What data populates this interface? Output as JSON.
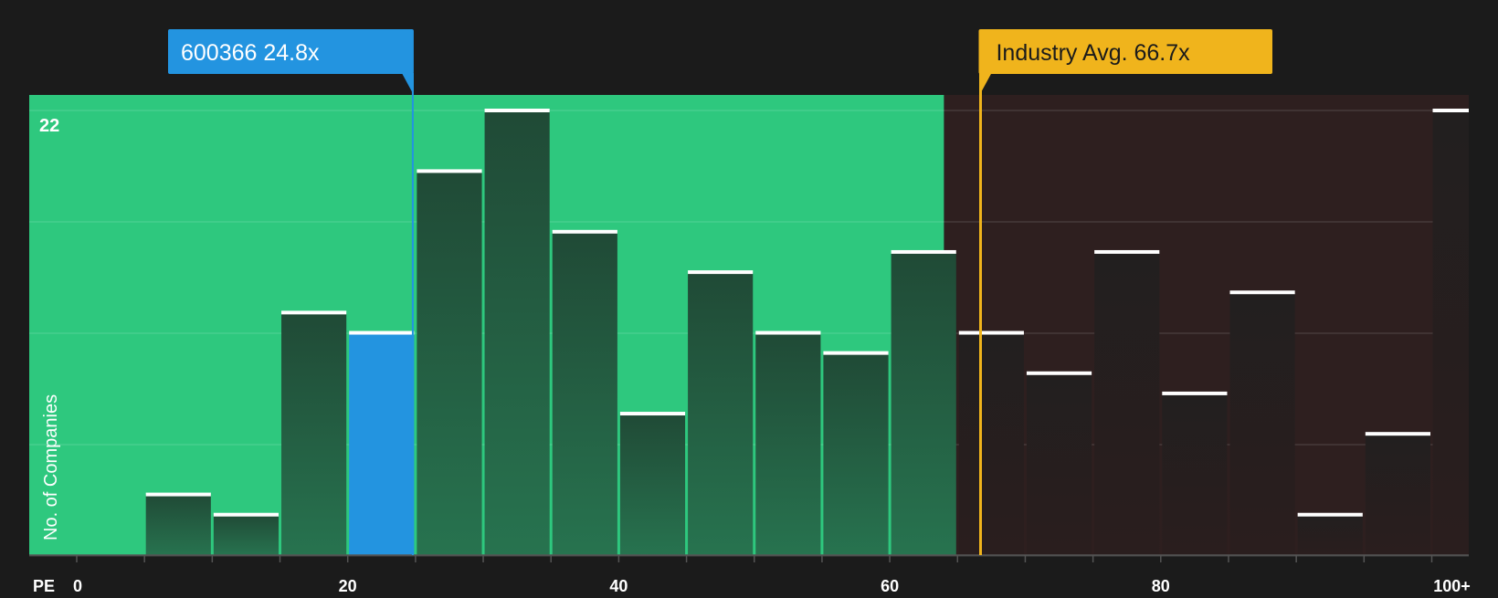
{
  "chart_data": {
    "type": "bar",
    "x_axis_label": "PE",
    "y_axis_label": "No. of Companies",
    "y_max_label": "22",
    "xlim": [
      0,
      100
    ],
    "ylim": [
      0,
      22
    ],
    "x_ticks": [
      {
        "value": 0,
        "label": "0"
      },
      {
        "value": 20,
        "label": "20"
      },
      {
        "value": 40,
        "label": "40"
      },
      {
        "value": 60,
        "label": "60"
      },
      {
        "value": 80,
        "label": "80"
      },
      {
        "value": 100,
        "label": "100+"
      }
    ],
    "bins": [
      {
        "start": 0,
        "end": 5,
        "count": 0
      },
      {
        "start": 5,
        "end": 10,
        "count": 3
      },
      {
        "start": 10,
        "end": 15,
        "count": 2
      },
      {
        "start": 15,
        "end": 20,
        "count": 12
      },
      {
        "start": 20,
        "end": 25,
        "count": 11
      },
      {
        "start": 25,
        "end": 30,
        "count": 19
      },
      {
        "start": 30,
        "end": 35,
        "count": 22
      },
      {
        "start": 35,
        "end": 40,
        "count": 16
      },
      {
        "start": 40,
        "end": 45,
        "count": 7
      },
      {
        "start": 45,
        "end": 50,
        "count": 14
      },
      {
        "start": 50,
        "end": 55,
        "count": 11
      },
      {
        "start": 55,
        "end": 60,
        "count": 10
      },
      {
        "start": 60,
        "end": 65,
        "count": 15
      },
      {
        "start": 65,
        "end": 70,
        "count": 11
      },
      {
        "start": 70,
        "end": 75,
        "count": 9
      },
      {
        "start": 75,
        "end": 80,
        "count": 15
      },
      {
        "start": 80,
        "end": 85,
        "count": 8
      },
      {
        "start": 85,
        "end": 90,
        "count": 13
      },
      {
        "start": 90,
        "end": 95,
        "count": 2
      },
      {
        "start": 95,
        "end": 100,
        "count": 6
      },
      {
        "start": 100,
        "end": 105,
        "count": 22
      }
    ],
    "fair_range_end": 64,
    "company": {
      "label": "600366 24.8x",
      "value": 24.8,
      "bin_index": 4
    },
    "industry": {
      "label": "Industry Avg. 66.7x",
      "value": 66.7
    },
    "colors": {
      "background": "#1b1b1b",
      "green_zone": "#2ec87e",
      "red_zone": "#2e1f1f",
      "bar_in_green": "#234d38",
      "bar_in_red": "#232020",
      "highlight_bar": "#2394e0",
      "company_marker": "#2394e0",
      "industry_marker": "#f0b41c",
      "bar_cap": "#ffffff",
      "axis_text": "#ffffff"
    }
  }
}
